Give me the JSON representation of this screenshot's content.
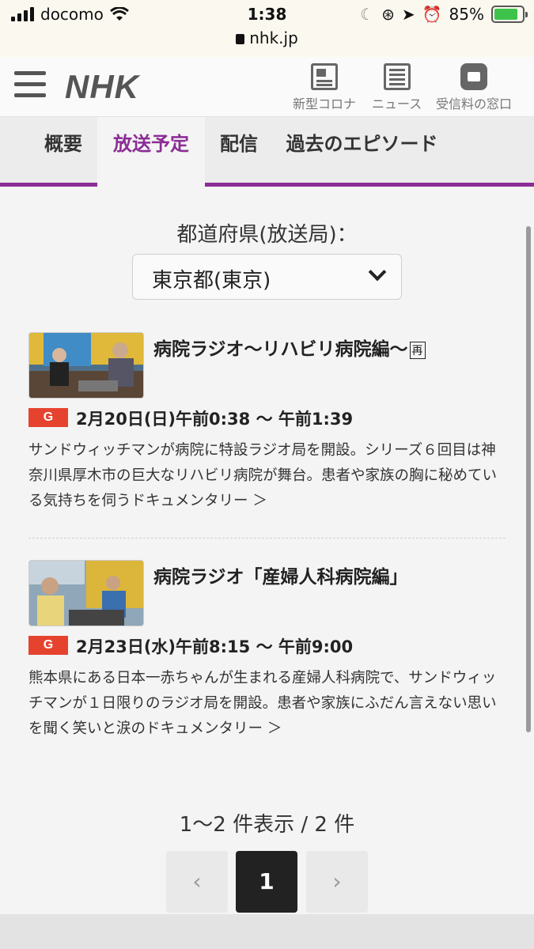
{
  "status_bar": {
    "carrier": "docomo",
    "time": "1:38",
    "url": "nhk.jp",
    "battery": "85%",
    "battery_level": 0.85
  },
  "header": {
    "logo": "NHK",
    "nav": [
      {
        "label": "新型コロナ",
        "icon": "corona-info-icon"
      },
      {
        "label": "ニュース",
        "icon": "news-icon"
      },
      {
        "label": "受信料の窓口",
        "icon": "domo-kun-icon"
      }
    ]
  },
  "tabs": [
    {
      "label": "概要",
      "active": false
    },
    {
      "label": "放送予定",
      "active": true
    },
    {
      "label": "配信",
      "active": false
    },
    {
      "label": "過去のエピソード",
      "active": false
    }
  ],
  "filter": {
    "label": "都道府県(放送局)：",
    "selected": "東京都(東京)"
  },
  "episodes": [
    {
      "title": "病院ラジオ〜リハビリ病院編〜",
      "rebroadcast_badge": "再",
      "channel": "G",
      "airtime": "2月20日(日)午前0:38 〜 午前1:39",
      "description": "サンドウィッチマンが病院に特設ラジオ局を開設。シリーズ６回目は神奈川県厚木市の巨大なリハビリ病院が舞台。患者や家族の胸に秘めている気持ちを伺うドキュメンタリー ＞"
    },
    {
      "title": "病院ラジオ「産婦人科病院編」",
      "channel": "G",
      "airtime": "2月23日(水)午前8:15 〜 午前9:00",
      "description": "熊本県にある日本一赤ちゃんが生まれる産婦人科病院で、サンドウィッチマンが１日限りのラジオ局を開設。患者や家族にふだん言えない思いを聞く笑いと涙のドキュメンタリー ＞"
    }
  ],
  "pagination": {
    "summary": "1〜2 件表示 /  2 件",
    "prev": "‹",
    "current": "1",
    "next": "›"
  },
  "colors": {
    "accent": "#8b2d94",
    "channel_badge": "#e5432e"
  }
}
